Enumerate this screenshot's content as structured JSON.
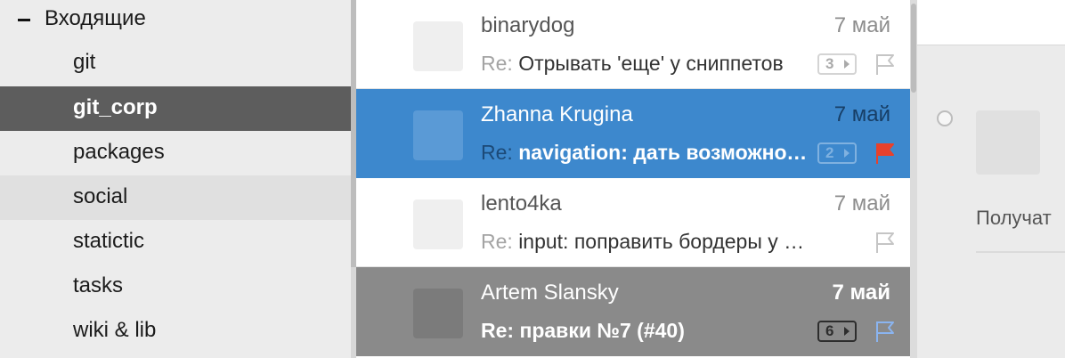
{
  "sidebar": {
    "root_folder": "Входящие",
    "folders": [
      {
        "label": "git"
      },
      {
        "label": "git_corp"
      },
      {
        "label": "packages"
      },
      {
        "label": "social"
      },
      {
        "label": "statictic"
      },
      {
        "label": "tasks"
      },
      {
        "label": "wiki & lib"
      }
    ],
    "active_folder": "git_corp"
  },
  "messages": [
    {
      "sender": "binarydog",
      "date": "7 май",
      "re": "Re:",
      "subject": "Отрывать 'еще' у сниппетов",
      "count": "3",
      "flagged": false,
      "state": "read"
    },
    {
      "sender": "Zhanna Krugina",
      "date": "7 май",
      "re": "Re:",
      "subject": "navigation: дать возможность",
      "count": "2",
      "flagged": true,
      "state": "selected"
    },
    {
      "sender": "lento4ka",
      "date": "7 май",
      "re": "Re:",
      "subject": "input: поправить бордеры у инпутов",
      "count": "",
      "flagged": false,
      "state": "read"
    },
    {
      "sender": "Artem Slansky",
      "date": "7 май",
      "re": "Re:",
      "subject": " правки №7 (#40)",
      "count": "6",
      "flagged": false,
      "state": "unread"
    }
  ],
  "reading_pane": {
    "recipient_label": "Получат"
  },
  "colors": {
    "selected_bg": "#3d88cd",
    "unread_bg": "#8a8a8a",
    "active_folder_bg": "#5d5d5d",
    "flag_red": "#e8412b",
    "flag_blue": "#8ab4f0"
  }
}
